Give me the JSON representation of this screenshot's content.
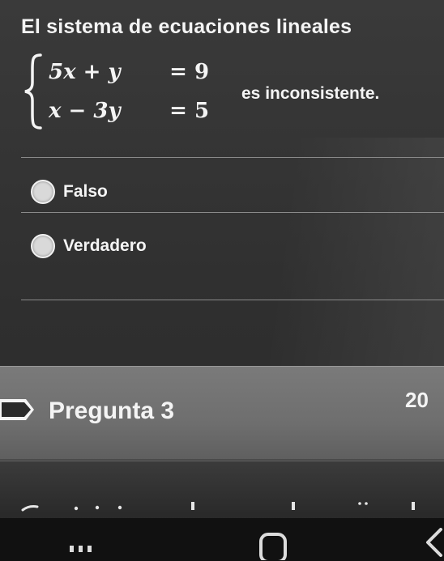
{
  "question": {
    "title": "El sistema de ecuaciones lineales",
    "equations": [
      {
        "lhs": "5x + y",
        "op": "=",
        "rhs": "9"
      },
      {
        "lhs": "x − 3y",
        "op": "=",
        "rhs": "5"
      }
    ],
    "suffix": "es inconsistente.",
    "options": [
      {
        "label": "Falso"
      },
      {
        "label": "Verdadero"
      }
    ]
  },
  "next_section": {
    "title": "Pregunta 3",
    "points": "20"
  },
  "colors": {
    "text": "#f4f4f4",
    "radio": "#d9d9d9",
    "section_band": "#747474",
    "nav_bar": "#111111"
  },
  "icons": {
    "section": "flag-marker-icon",
    "nav": [
      "recent-apps-icon",
      "home-icon",
      "back-icon"
    ]
  }
}
